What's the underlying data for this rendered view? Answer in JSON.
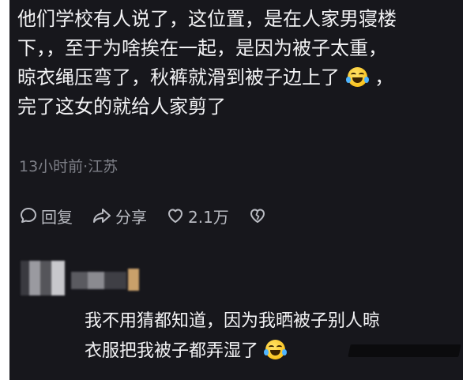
{
  "comment": {
    "line1": "他们学校有人说了，这位置，是在人家男寝楼",
    "line2": "下，，至于为啥挨在一起，是因为被子太重，",
    "line3_before": "晾衣绳压弯了，秋裤就滑到被子边上了",
    "line3_after": "，",
    "line4": "完了这女的就给人家剪了",
    "meta": "13小时前·江苏"
  },
  "actions": {
    "reply_label": "回复",
    "share_label": "分享",
    "like_count": "2.1万"
  },
  "reply": {
    "line1": "我不用猜都知道，因为我晒被子别人晾",
    "line2": "衣服把我被子都弄湿了"
  },
  "icons": {
    "reply": "comment-bubble-icon",
    "share": "share-arrow-icon",
    "like": "heart-icon",
    "dislike": "broken-heart-icon",
    "emoji1": "rofl-emoji-icon",
    "emoji2": "crying-laughing-emoji-icon"
  }
}
